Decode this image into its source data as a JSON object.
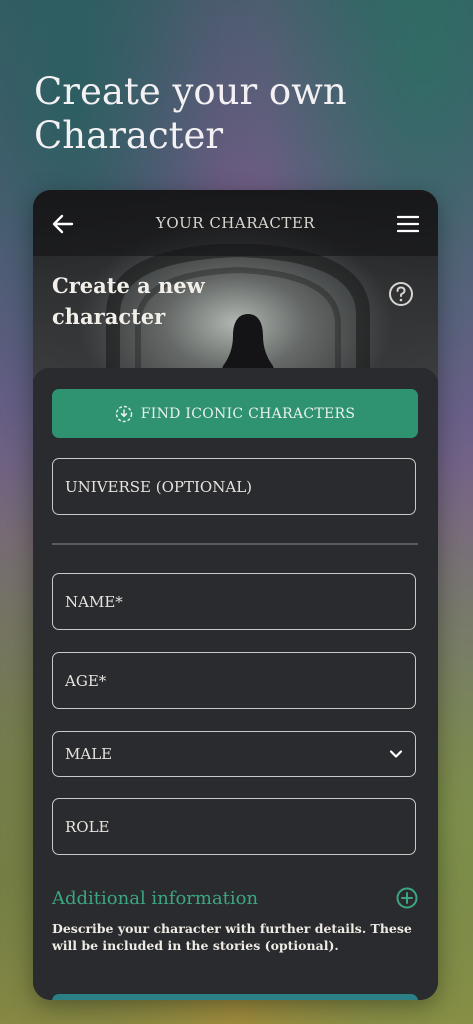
{
  "hero": {
    "title": "Create your own Character"
  },
  "topbar": {
    "title": "YOUR CHARACTER"
  },
  "header": {
    "heading": "Create a new character"
  },
  "form": {
    "find_button_label": "FIND ICONIC CHARACTERS",
    "universe_placeholder": "UNIVERSE (OPTIONAL)",
    "name_placeholder": "NAME*",
    "age_placeholder": "AGE*",
    "gender_selected": "MALE",
    "role_placeholder": "ROLE",
    "additional_label": "Additional information",
    "additional_description": "Describe your character with further details. These will be included in the stories (optional)."
  },
  "colors": {
    "accent": "#2f9270",
    "accent_text": "#3ca680",
    "card_background": "#2a2b2e"
  },
  "icons": [
    "back-arrow-icon",
    "hamburger-menu-icon",
    "help-icon",
    "download-circle-icon",
    "chevron-down-icon",
    "plus-circle-icon"
  ]
}
